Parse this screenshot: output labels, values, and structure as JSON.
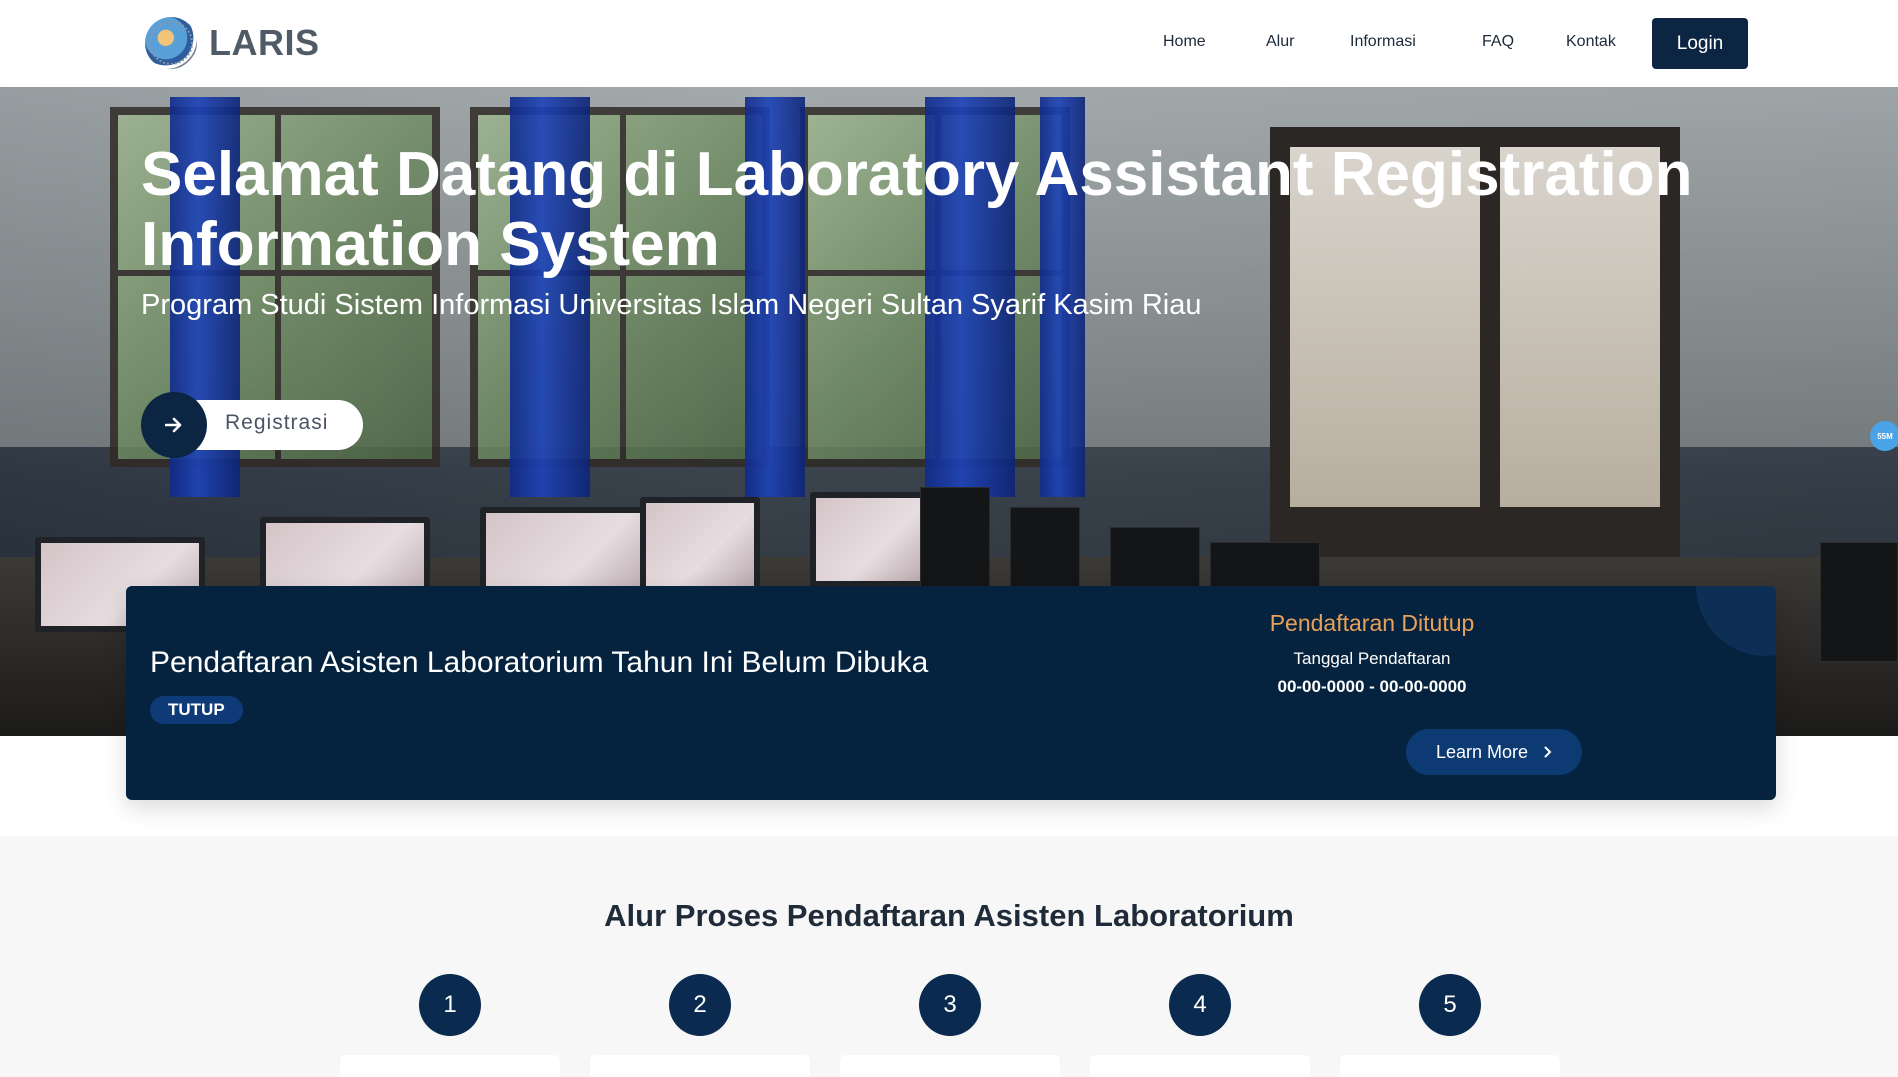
{
  "brand": {
    "name": "LARIS",
    "logo_icon": "university-seal-icon"
  },
  "nav": {
    "items": [
      {
        "label": "Home",
        "active": true
      },
      {
        "label": "Alur",
        "active": false
      },
      {
        "label": "Informasi",
        "active": false
      },
      {
        "label": "FAQ",
        "active": false
      },
      {
        "label": "Kontak",
        "active": false
      }
    ],
    "login_label": "Login"
  },
  "hero": {
    "title": "Selamat Datang di Laboratory Assistant Registration Information System",
    "subtitle": "Program Studi Sistem Informasi Universitas Islam Negeri Sultan Syarif Kasim Riau",
    "register_label": "Registrasi",
    "register_icon": "arrow-right-icon"
  },
  "side_badge": "55M",
  "status": {
    "title": "Pendaftaran Asisten Laboratorium Tahun Ini Belum Dibuka",
    "badge": "TUTUP",
    "closed_label": "Pendaftaran Ditutup",
    "date_label": "Tanggal Pendaftaran",
    "date_value": "00-00-0000 - 00-00-0000",
    "learn_more_label": "Learn More",
    "learn_more_icon": "chevron-right-icon"
  },
  "alur": {
    "title": "Alur Proses Pendaftaran Asisten Laboratorium",
    "steps": [
      "1",
      "2",
      "3",
      "4",
      "5"
    ]
  },
  "colors": {
    "navy": "#0b2542",
    "card": "#05233f",
    "accent_orange": "#e8a15a",
    "badge_blue": "#0f3a78"
  }
}
